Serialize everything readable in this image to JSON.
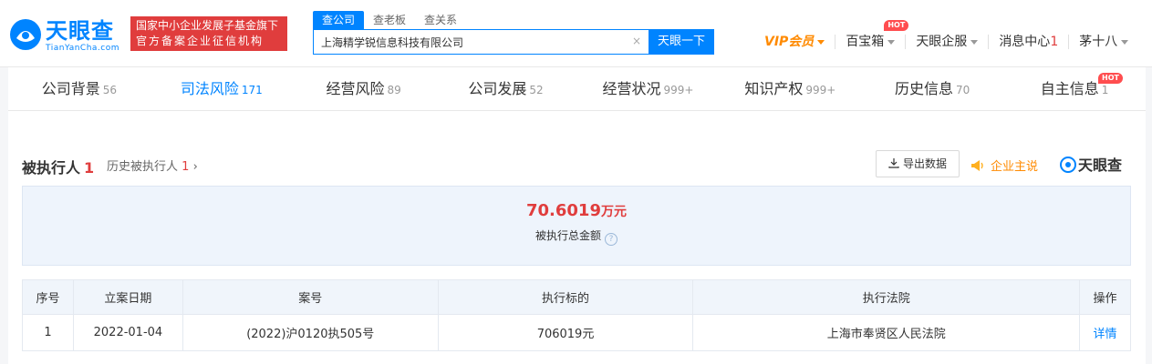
{
  "header": {
    "logo": {
      "text": "天眼查",
      "sub": "TianYanCha.com"
    },
    "banner": {
      "line1": "国家中小企业发展子基金旗下",
      "line2": "官方备案企业征信机构"
    },
    "search_tabs": [
      "查公司",
      "查老板",
      "查关系"
    ],
    "search_value": "上海精学锐信息科技有限公司",
    "search_button": "天眼一下",
    "clear_icon": "×",
    "nav": {
      "vip": "VIP会员",
      "treasure": "百宝箱",
      "hot_label": "HOT",
      "enterprise": "天眼企服",
      "messages": "消息中心",
      "messages_count": "1",
      "user": "茅十八"
    }
  },
  "company_tabs": [
    {
      "label": "公司背景",
      "count": "56"
    },
    {
      "label": "司法风险",
      "count": "171",
      "active": true
    },
    {
      "label": "经营风险",
      "count": "89"
    },
    {
      "label": "公司发展",
      "count": "52"
    },
    {
      "label": "经营状况",
      "count": "999+"
    },
    {
      "label": "知识产权",
      "count": "999+"
    },
    {
      "label": "历史信息",
      "count": "70"
    },
    {
      "label": "自主信息",
      "count": "1",
      "hot": "HOT"
    }
  ],
  "section": {
    "title": "被执行人",
    "title_count": "1",
    "history_label": "历史被执行人",
    "history_count": "1",
    "history_arrow": "›",
    "export_label": "导出数据",
    "promo_label": "企业主说",
    "brand": "天眼查"
  },
  "summary": {
    "value": "70.6019",
    "unit": "万元",
    "label": "被执行总金额",
    "help": "?"
  },
  "table": {
    "headers": [
      "序号",
      "立案日期",
      "案号",
      "执行标的",
      "执行法院",
      "操作"
    ],
    "rows": [
      [
        "1",
        "2022-01-04",
        "(2022)沪0120执505号",
        "706019元",
        "上海市奉贤区人民法院",
        "详情"
      ]
    ]
  },
  "colors": {
    "brand_blue": "#0084ff",
    "alert_red": "#e03d3d",
    "vip_orange": "#ff8a00"
  }
}
